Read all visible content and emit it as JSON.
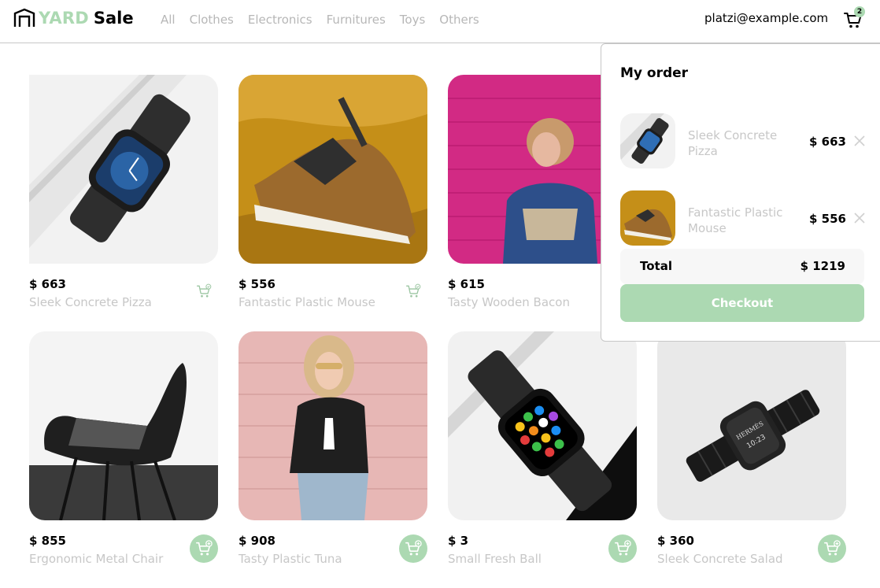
{
  "brand": {
    "yard": "YARD",
    "sale": "Sale"
  },
  "nav": {
    "items": [
      "All",
      "Clothes",
      "Electronics",
      "Furnitures",
      "Toys",
      "Others"
    ]
  },
  "user": {
    "email": "platzi@example.com"
  },
  "cart": {
    "count": "2",
    "icon": "cart-icon"
  },
  "products": [
    {
      "price": "$ 663",
      "name": "Sleek Concrete Pizza"
    },
    {
      "price": "$ 556",
      "name": "Fantastic Plastic Mouse"
    },
    {
      "price": "$ 615",
      "name": "Tasty Wooden Bacon"
    },
    {
      "price": "$ 855",
      "name": "Ergonomic Metal Chair"
    },
    {
      "price": "$ 908",
      "name": "Tasty Plastic Tuna"
    },
    {
      "price": "$ 3",
      "name": "Small Fresh Ball"
    },
    {
      "price": "$ 360",
      "name": "Sleek Concrete Salad"
    }
  ],
  "order": {
    "title": "My order",
    "items": [
      {
        "name": "Sleek Concrete Pizza",
        "price": "$ 663"
      },
      {
        "name": "Fantastic Plastic Mouse",
        "price": "$ 556"
      }
    ],
    "total_label": "Total",
    "total_value": "$ 1219",
    "checkout_label": "Checkout"
  },
  "colors": {
    "accent": "#acd9b2",
    "muted_text": "#c7c7c7",
    "border": "#c7c7c7"
  }
}
